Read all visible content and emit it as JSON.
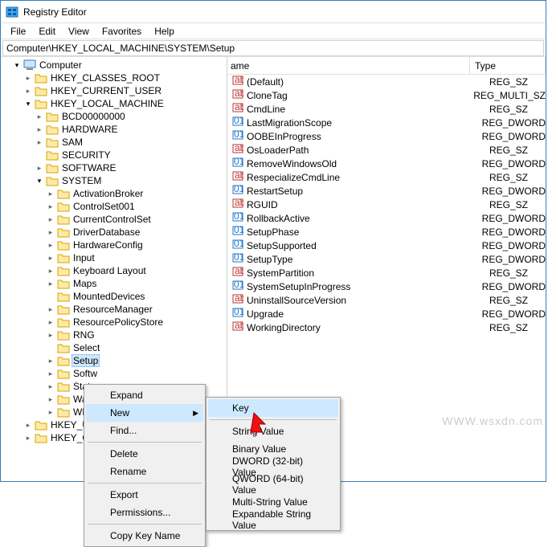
{
  "window": {
    "title": "Registry Editor"
  },
  "menu": {
    "file": "File",
    "edit": "Edit",
    "view": "View",
    "favorites": "Favorites",
    "help": "Help"
  },
  "path": {
    "value": "Computer\\HKEY_LOCAL_MACHINE\\SYSTEM\\Setup"
  },
  "tree": {
    "root": "Computer",
    "hkcr": "HKEY_CLASSES_ROOT",
    "hkcu": "HKEY_CURRENT_USER",
    "hklm": "HKEY_LOCAL_MACHINE",
    "bcd": "BCD00000000",
    "hardware": "HARDWARE",
    "sam": "SAM",
    "security": "SECURITY",
    "software": "SOFTWARE",
    "system": "SYSTEM",
    "activationbroker": "ActivationBroker",
    "controlset001": "ControlSet001",
    "currentcontrolset": "CurrentControlSet",
    "driverdatabase": "DriverDatabase",
    "hardwareconfig": "HardwareConfig",
    "input": "Input",
    "keyboardlayout": "Keyboard Layout",
    "maps": "Maps",
    "mounteddevices": "MountedDevices",
    "resourcemanager": "ResourceManager",
    "resourcepolicystore": "ResourcePolicyStore",
    "rng": "RNG",
    "select": "Select",
    "setup": "Setup",
    "softw": "Softw",
    "state": "State",
    "waas": "WaaS",
    "wpa": "WPA",
    "hkusers": "HKEY_USER",
    "hkcc": "HKEY_CUR"
  },
  "list": {
    "col_name": "ame",
    "col_type": "Type",
    "rows": [
      {
        "name": "(Default)",
        "type": "REG_SZ"
      },
      {
        "name": "CloneTag",
        "type": "REG_MULTI_SZ"
      },
      {
        "name": "CmdLine",
        "type": "REG_SZ"
      },
      {
        "name": "LastMigrationScope",
        "type": "REG_DWORD"
      },
      {
        "name": "OOBEInProgress",
        "type": "REG_DWORD"
      },
      {
        "name": "OsLoaderPath",
        "type": "REG_SZ"
      },
      {
        "name": "RemoveWindowsOld",
        "type": "REG_DWORD"
      },
      {
        "name": "RespecializeCmdLine",
        "type": "REG_SZ"
      },
      {
        "name": "RestartSetup",
        "type": "REG_DWORD"
      },
      {
        "name": "RGUID",
        "type": "REG_SZ"
      },
      {
        "name": "RollbackActive",
        "type": "REG_DWORD"
      },
      {
        "name": "SetupPhase",
        "type": "REG_DWORD"
      },
      {
        "name": "SetupSupported",
        "type": "REG_DWORD"
      },
      {
        "name": "SetupType",
        "type": "REG_DWORD"
      },
      {
        "name": "SystemPartition",
        "type": "REG_SZ"
      },
      {
        "name": "SystemSetupInProgress",
        "type": "REG_DWORD"
      },
      {
        "name": "UninstallSourceVersion",
        "type": "REG_SZ"
      },
      {
        "name": "Upgrade",
        "type": "REG_DWORD"
      },
      {
        "name": "WorkingDirectory",
        "type": "REG_SZ"
      }
    ]
  },
  "ctx1": {
    "expand": "Expand",
    "new": "New",
    "find": "Find...",
    "delete": "Delete",
    "rename": "Rename",
    "export": "Export",
    "permissions": "Permissions...",
    "copykeyname": "Copy Key Name"
  },
  "ctx2": {
    "key": "Key",
    "string": "String Value",
    "binary": "Binary Value",
    "dword": "DWORD (32-bit) Value",
    "qword": "QWORD (64-bit) Value",
    "multistring": "Multi-String Value",
    "expandable": "Expandable String Value"
  },
  "watermark": "WWW.wsxdn.com"
}
